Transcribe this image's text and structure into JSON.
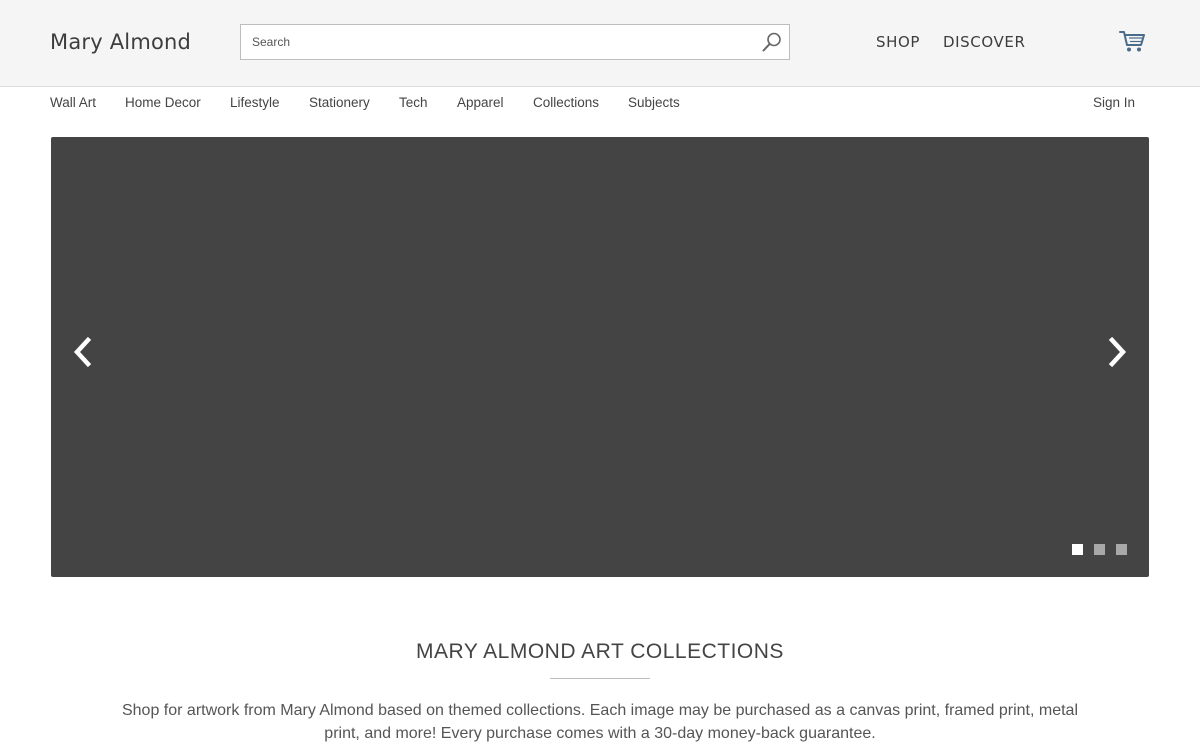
{
  "header": {
    "brand": "Mary Almond",
    "search": {
      "placeholder": "Search",
      "value": "",
      "icon": "search-icon"
    },
    "nav": [
      {
        "label": "SHOP"
      },
      {
        "label": "DISCOVER"
      }
    ],
    "cart": {
      "icon": "cart-icon"
    }
  },
  "categories": [
    {
      "label": "Wall Art"
    },
    {
      "label": "Home Decor"
    },
    {
      "label": "Lifestyle"
    },
    {
      "label": "Stationery"
    },
    {
      "label": "Tech"
    },
    {
      "label": "Apparel"
    },
    {
      "label": "Collections"
    },
    {
      "label": "Subjects"
    }
  ],
  "account": {
    "sign_in": "Sign In"
  },
  "carousel": {
    "background": "#444444",
    "prev_icon": "chevron-left-icon",
    "next_icon": "chevron-right-icon",
    "slide_count": 3,
    "active_slide": 1,
    "active_dot_color": "#ffffff",
    "inactive_dot_color": "#a8a8a8"
  },
  "section": {
    "title": "MARY ALMOND ART COLLECTIONS",
    "description": "Shop for artwork from Mary Almond based on themed collections. Each image may be purchased as a canvas print, framed print, metal print, and more! Every purchase comes with a 30-day money-back guarantee."
  }
}
